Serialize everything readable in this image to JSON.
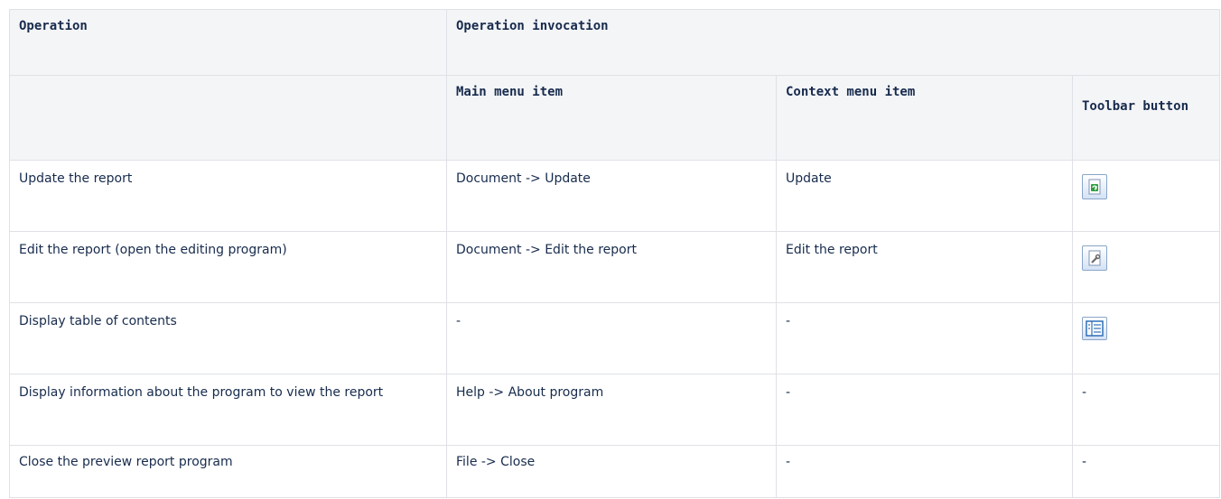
{
  "headers": {
    "operation": "Operation",
    "invocation": "Operation invocation",
    "main_menu": "Main menu item",
    "context_menu": "Context menu item",
    "toolbar": "Toolbar button"
  },
  "rows": [
    {
      "operation": "Update the report",
      "main": "Document -> Update",
      "context": "Update",
      "toolbar_icon": "refresh-document-icon"
    },
    {
      "operation": "Edit the report (open the editing program)",
      "main": "Document -> Edit the report",
      "context": "Edit the report",
      "toolbar_icon": "edit-document-icon"
    },
    {
      "operation": "Display table of contents",
      "main": "-",
      "context": "-",
      "toolbar_icon": "table-of-contents-icon"
    },
    {
      "operation": "Display information about the program to view the report",
      "main": "Help -> About program",
      "context": "-",
      "toolbar": "-"
    },
    {
      "operation": "Close the preview report program",
      "main": "File -> Close",
      "context": "-",
      "toolbar": "-"
    }
  ]
}
